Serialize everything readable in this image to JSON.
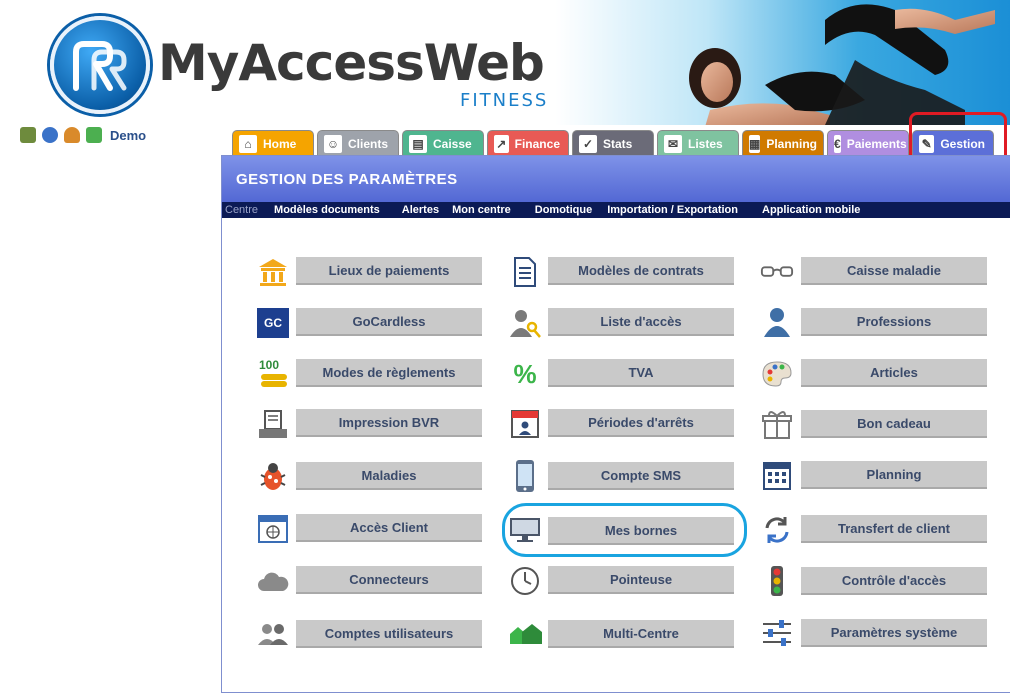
{
  "header": {
    "logo_name": "MyAccessWeb",
    "logo_sub": "FITNESS"
  },
  "quick": {
    "user_label": "Demo"
  },
  "tabs": [
    {
      "label": "Home",
      "color": "#f5a400"
    },
    {
      "label": "Clients",
      "color": "#9ea3ab"
    },
    {
      "label": "Caisse",
      "color": "#4fb58f"
    },
    {
      "label": "Finance",
      "color": "#e85a55"
    },
    {
      "label": "Stats",
      "color": "#6b6b78"
    },
    {
      "label": "Listes",
      "color": "#7fc3a0"
    },
    {
      "label": "Planning",
      "color": "#d07a00"
    },
    {
      "label": "Paiements",
      "color": "#b08ee0"
    },
    {
      "label": "Gestion",
      "color": "#5c6fd8"
    }
  ],
  "panel": {
    "title": "GESTION DES PARAMÈTRES",
    "subnav": [
      "Centre",
      "Modèles documents",
      "Alertes",
      "Mon centre",
      "Domotique",
      "Importation / Exportation",
      "Application mobile"
    ]
  },
  "grid": {
    "col1": [
      "Lieux de paiements",
      "GoCardless",
      "Modes de règlements",
      "Impression BVR",
      "Maladies",
      "Accès Client",
      "Connecteurs",
      "Comptes utilisateurs"
    ],
    "col2": [
      "Modèles de contrats",
      "Liste d'accès",
      "TVA",
      "Périodes d'arrêts",
      "Compte SMS",
      "Mes bornes",
      "Pointeuse",
      "Multi-Centre"
    ],
    "col3": [
      "Caisse maladie",
      "Professions",
      "Articles",
      "Bon cadeau",
      "Planning",
      "Transfert de client",
      "Contrôle d'accès",
      "Paramètres système"
    ]
  },
  "icons": {
    "gocardless_text": "GC",
    "modes_text": "100",
    "tva_text": "%"
  },
  "colors": {
    "accent": "#5368d4",
    "highlight_red": "#e01b24",
    "highlight_blue": "#19a4e0"
  }
}
